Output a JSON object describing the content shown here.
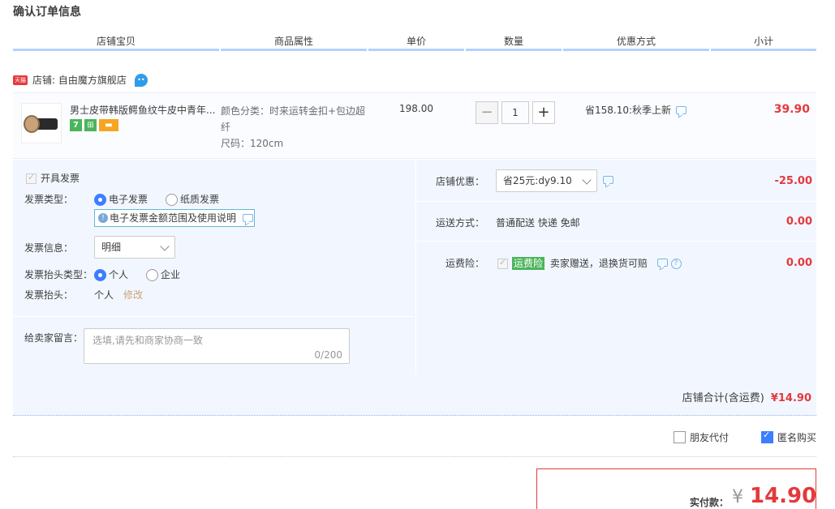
{
  "page": {
    "title": "确认订单信息"
  },
  "columns": [
    "店铺宝贝",
    "商品属性",
    "单价",
    "数量",
    "优惠方式",
    "小计"
  ],
  "shop": {
    "badge": "天猫",
    "label": "店铺: 自由魔方旗舰店"
  },
  "item": {
    "name": "男士皮带韩版鳄鱼纹牛皮中青年...",
    "badge_7": "7",
    "attr_color": "颜色分类：时来运转金扣+包边超纤",
    "attr_size": "尺码：120cm",
    "unit_price": "198.00",
    "qty": "1",
    "qty_minus": "−",
    "qty_plus": "+",
    "promo": "省158.10:秋季上新",
    "subtotal": "39.90"
  },
  "invoice": {
    "open_label": "开具发票",
    "type_label": "发票类型：",
    "type_electronic": "电子发票",
    "type_paper": "纸质发票",
    "info_link": "电子发票金额范围及使用说明",
    "info_label": "发票信息：",
    "info_value": "明细",
    "header_type_label": "发票抬头类型：",
    "header_personal": "个人",
    "header_company": "企业",
    "header_label": "发票抬头：",
    "header_value": "个人",
    "edit": "修改"
  },
  "message": {
    "label": "给卖家留言：",
    "placeholder": "选填,请先和商家协商一致",
    "count": "0/200"
  },
  "right": {
    "shop_discount_label": "店铺优惠：",
    "shop_discount_value": "省25元:dy9.10",
    "shop_discount_amount": "-25.00",
    "shipping_label": "运送方式：",
    "shipping_value": "普通配送 快递 免邮",
    "shipping_amount": "0.00",
    "insurance_label": "运费险：",
    "insurance_tag": "运费险",
    "insurance_text": "卖家赠送，退换货可赔",
    "insurance_amount": "0.00"
  },
  "shop_total": {
    "label": "店铺合计(含运费)",
    "amount": "¥14.90"
  },
  "options": {
    "friend_pay": "朋友代付",
    "anonymous": "匿名购买"
  },
  "pay": {
    "label": "实付款：",
    "yen": "¥",
    "amount": "14.90"
  },
  "colors": {
    "accent_red": "#e4393c",
    "panel_bg": "#f2f7ff",
    "header_bar": "#b2d1ff",
    "blue": "#3d7eff"
  }
}
